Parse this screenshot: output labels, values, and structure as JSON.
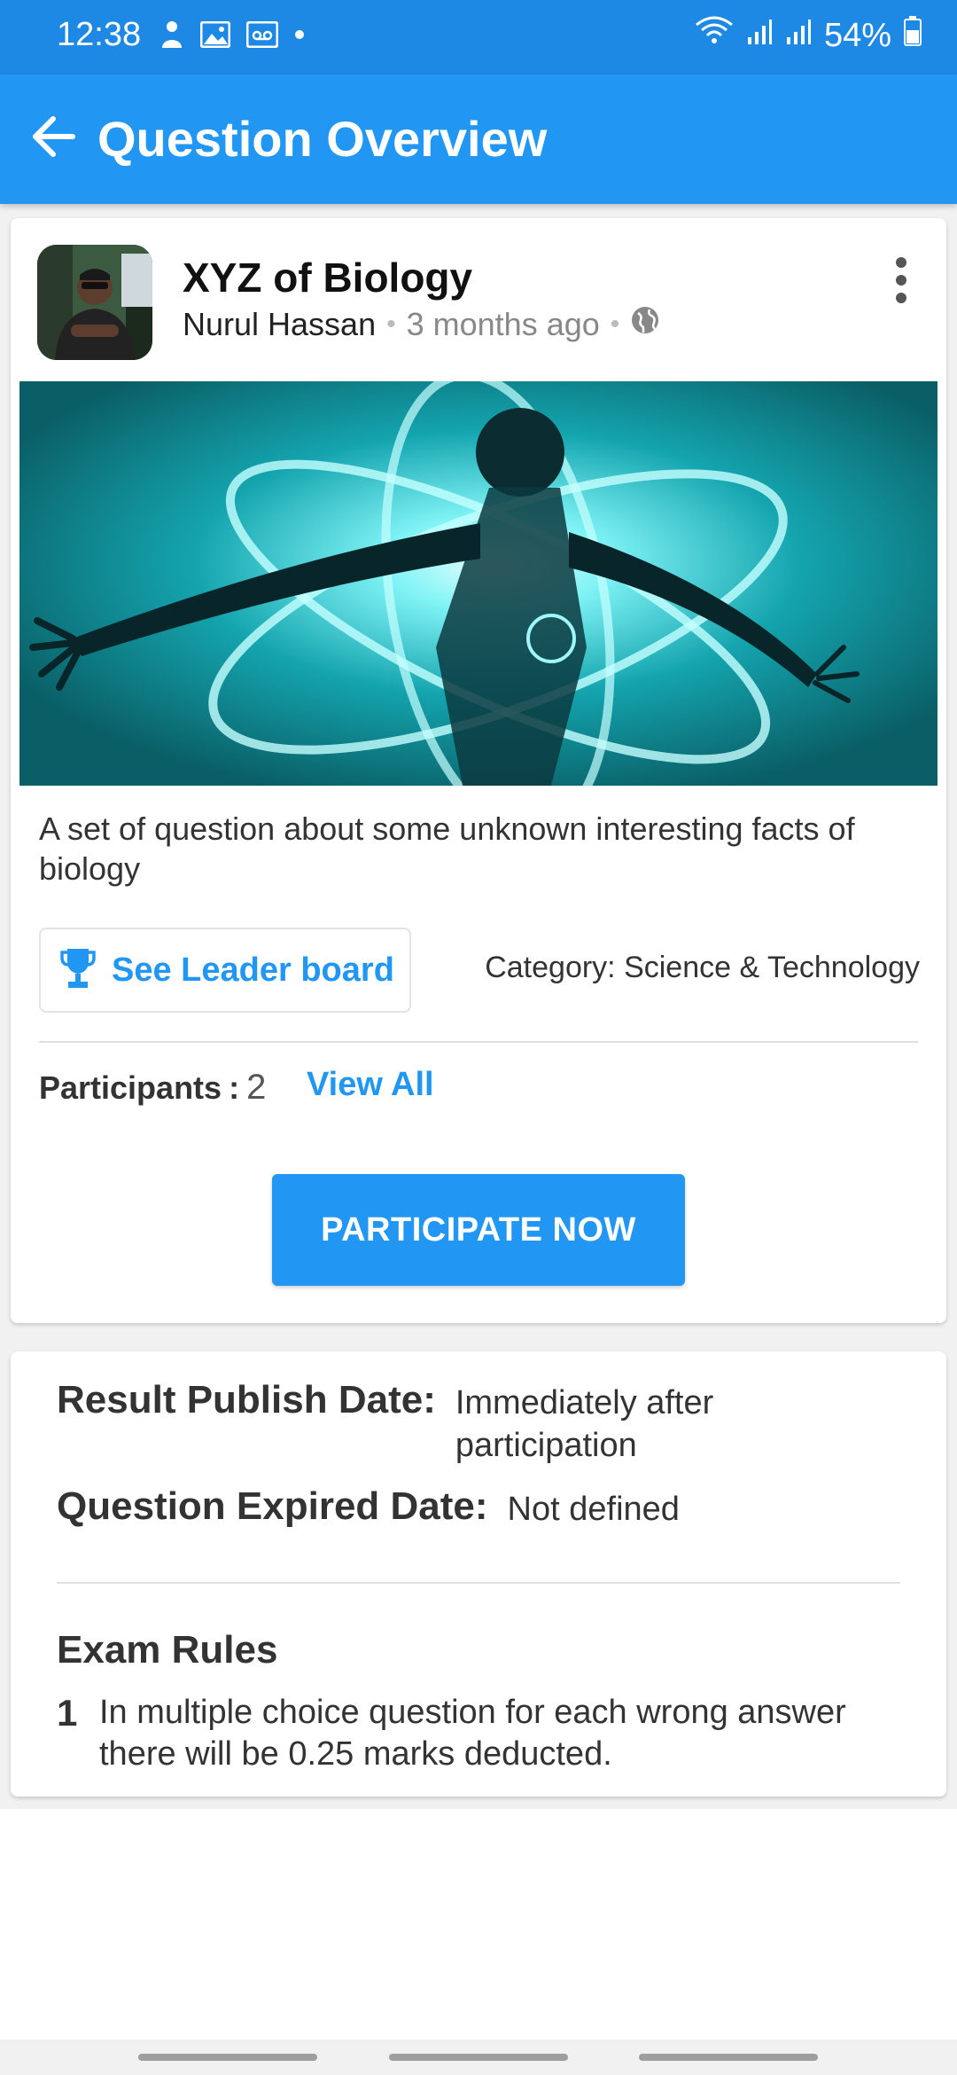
{
  "status_bar": {
    "time": "12:38",
    "battery": "54%",
    "icons": [
      "person-icon",
      "image-icon",
      "voicemail-icon",
      "dot-icon",
      "wifi-icon",
      "signal-icon",
      "signal-icon",
      "battery-icon"
    ]
  },
  "app_bar": {
    "title": "Question Overview",
    "back_icon": "arrow-left-icon"
  },
  "post": {
    "title": "XYZ of Biology",
    "author": "Nurul Hassan",
    "time_ago": "3 months ago",
    "visibility_icon": "globe-icon",
    "menu_icon": "more-vert-icon",
    "description": "A set of question about some unknown interesting facts of biology",
    "leaderboard_label": "See Leader board",
    "leaderboard_icon": "trophy-icon",
    "category": "Category: Science & Technology",
    "participants_label": "Participants",
    "participants_sep": ":",
    "participants_count": "2",
    "view_all_label": "View All",
    "participate_label": "PARTICIPATE NOW"
  },
  "details": {
    "result_publish_label": "Result Publish Date:",
    "result_publish_value": "Immediately after participation",
    "expired_label": "Question Expired Date:",
    "expired_value": "Not defined",
    "rules_title": "Exam Rules",
    "rules": [
      {
        "number": "1",
        "text": "In multiple choice question for each wrong answer there will be 0.25 marks deducted."
      }
    ]
  },
  "colors": {
    "primary": "#2196f3",
    "status_bar": "#1e88e5",
    "background": "#f1f1f1"
  }
}
